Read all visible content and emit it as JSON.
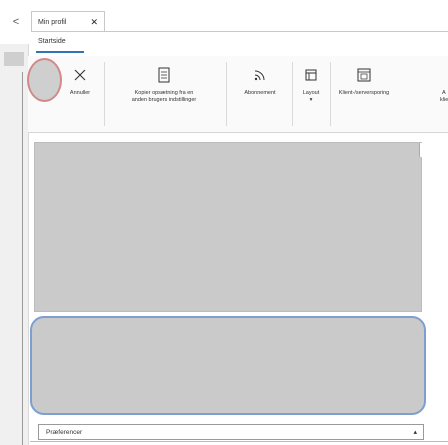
{
  "nav": {
    "back_glyph": "<"
  },
  "tabs": [
    {
      "label": "Min profil",
      "close_glyph": "✕"
    }
  ],
  "ribbon": {
    "active_tab": "Startside",
    "buttons": [
      {
        "label": "Annuller",
        "icon": "close-icon"
      },
      {
        "label": "Kopier opsætning fra en anden brugers indstillinger",
        "line1": "Kopier opsætning fra en",
        "line2": "anden brugers indstillinger",
        "icon": "copy-document-icon"
      },
      {
        "label": "Abonnement",
        "icon": "rss-feed-icon"
      },
      {
        "label": "Layout",
        "icon": "layout-window-icon",
        "caret": "▾"
      },
      {
        "label": "Klient-/serversporing",
        "icon": "tracing-window-icon"
      },
      {
        "label_top": "A",
        "label_bottom": "klien"
      }
    ]
  },
  "footer": {
    "section_label": "Præferencer",
    "collapse_glyph": "▴"
  },
  "colors": {
    "accent": "#2e75b6",
    "panel_border": "#7d9fd0",
    "highlight": "#d08a8a"
  }
}
